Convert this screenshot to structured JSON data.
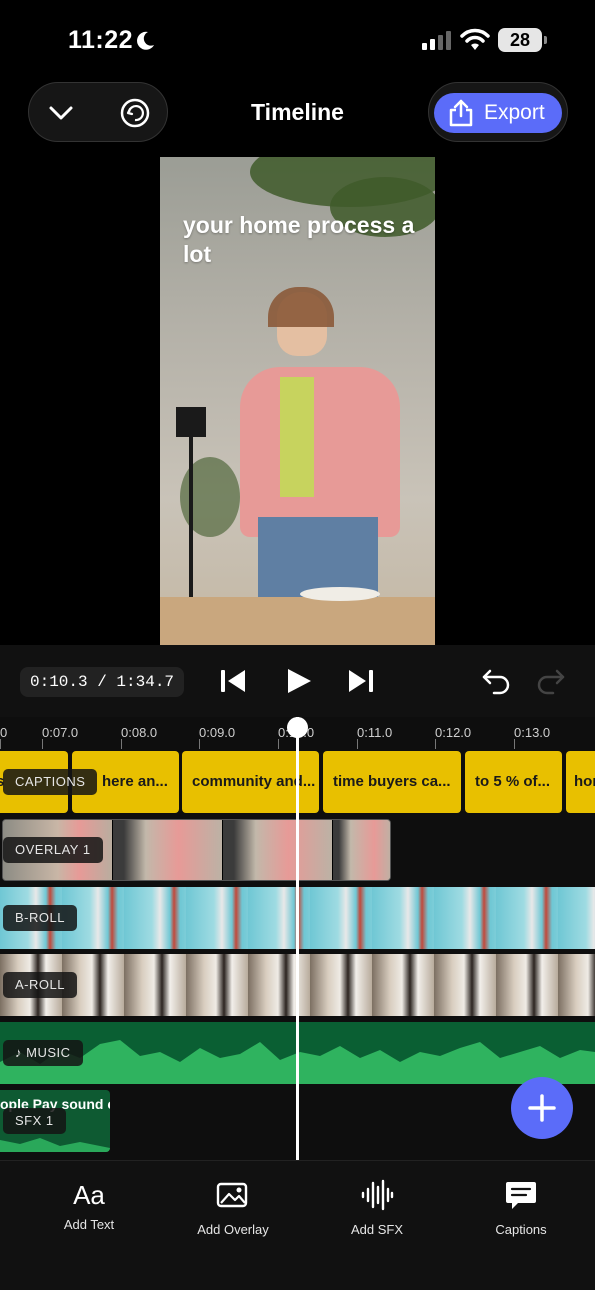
{
  "status_bar": {
    "time": "11:22",
    "battery": "28"
  },
  "header": {
    "title": "Timeline",
    "export_label": "Export"
  },
  "preview": {
    "caption": "your home process a lot"
  },
  "playback": {
    "timecode": "0:10.3 / 1:34.7"
  },
  "ruler": {
    "ticks": [
      "0",
      "0:07.0",
      "0:08.0",
      "0:09.0",
      "0:10.0",
      "0:11.0",
      "0:12.0",
      "0:13.0"
    ]
  },
  "tracks": {
    "captions": {
      "label": "CAPTIONS",
      "clips": [
        "s",
        "here an...",
        "community and...",
        "time buyers ca...",
        "to 5 % of...",
        "hor"
      ]
    },
    "overlay": {
      "label": "OVERLAY 1"
    },
    "broll": {
      "label": "B-ROLL"
    },
    "aroll": {
      "label": "A-ROLL"
    },
    "music": {
      "label": "♪ MUSIC"
    },
    "sfx": {
      "label": "SFX 1",
      "clip": "ople Pay sound ef"
    }
  },
  "toolbar": {
    "add_text_glyph": "Aa",
    "add_text": "Add Text",
    "add_overlay": "Add Overlay",
    "add_sfx": "Add SFX",
    "captions": "Captions"
  },
  "colors": {
    "accent": "#5b6cf9",
    "captions": "#e8c000",
    "music": "#1f9a4f",
    "broll": "#6fc7d4"
  },
  "icons": [
    "moon-icon",
    "signal-icon",
    "wifi-icon",
    "chevron-down-icon",
    "history-icon",
    "share-icon",
    "skip-back-icon",
    "play-icon",
    "skip-forward-icon",
    "undo-icon",
    "redo-icon",
    "plus-icon",
    "image-icon",
    "waveform-icon",
    "captions-icon"
  ]
}
